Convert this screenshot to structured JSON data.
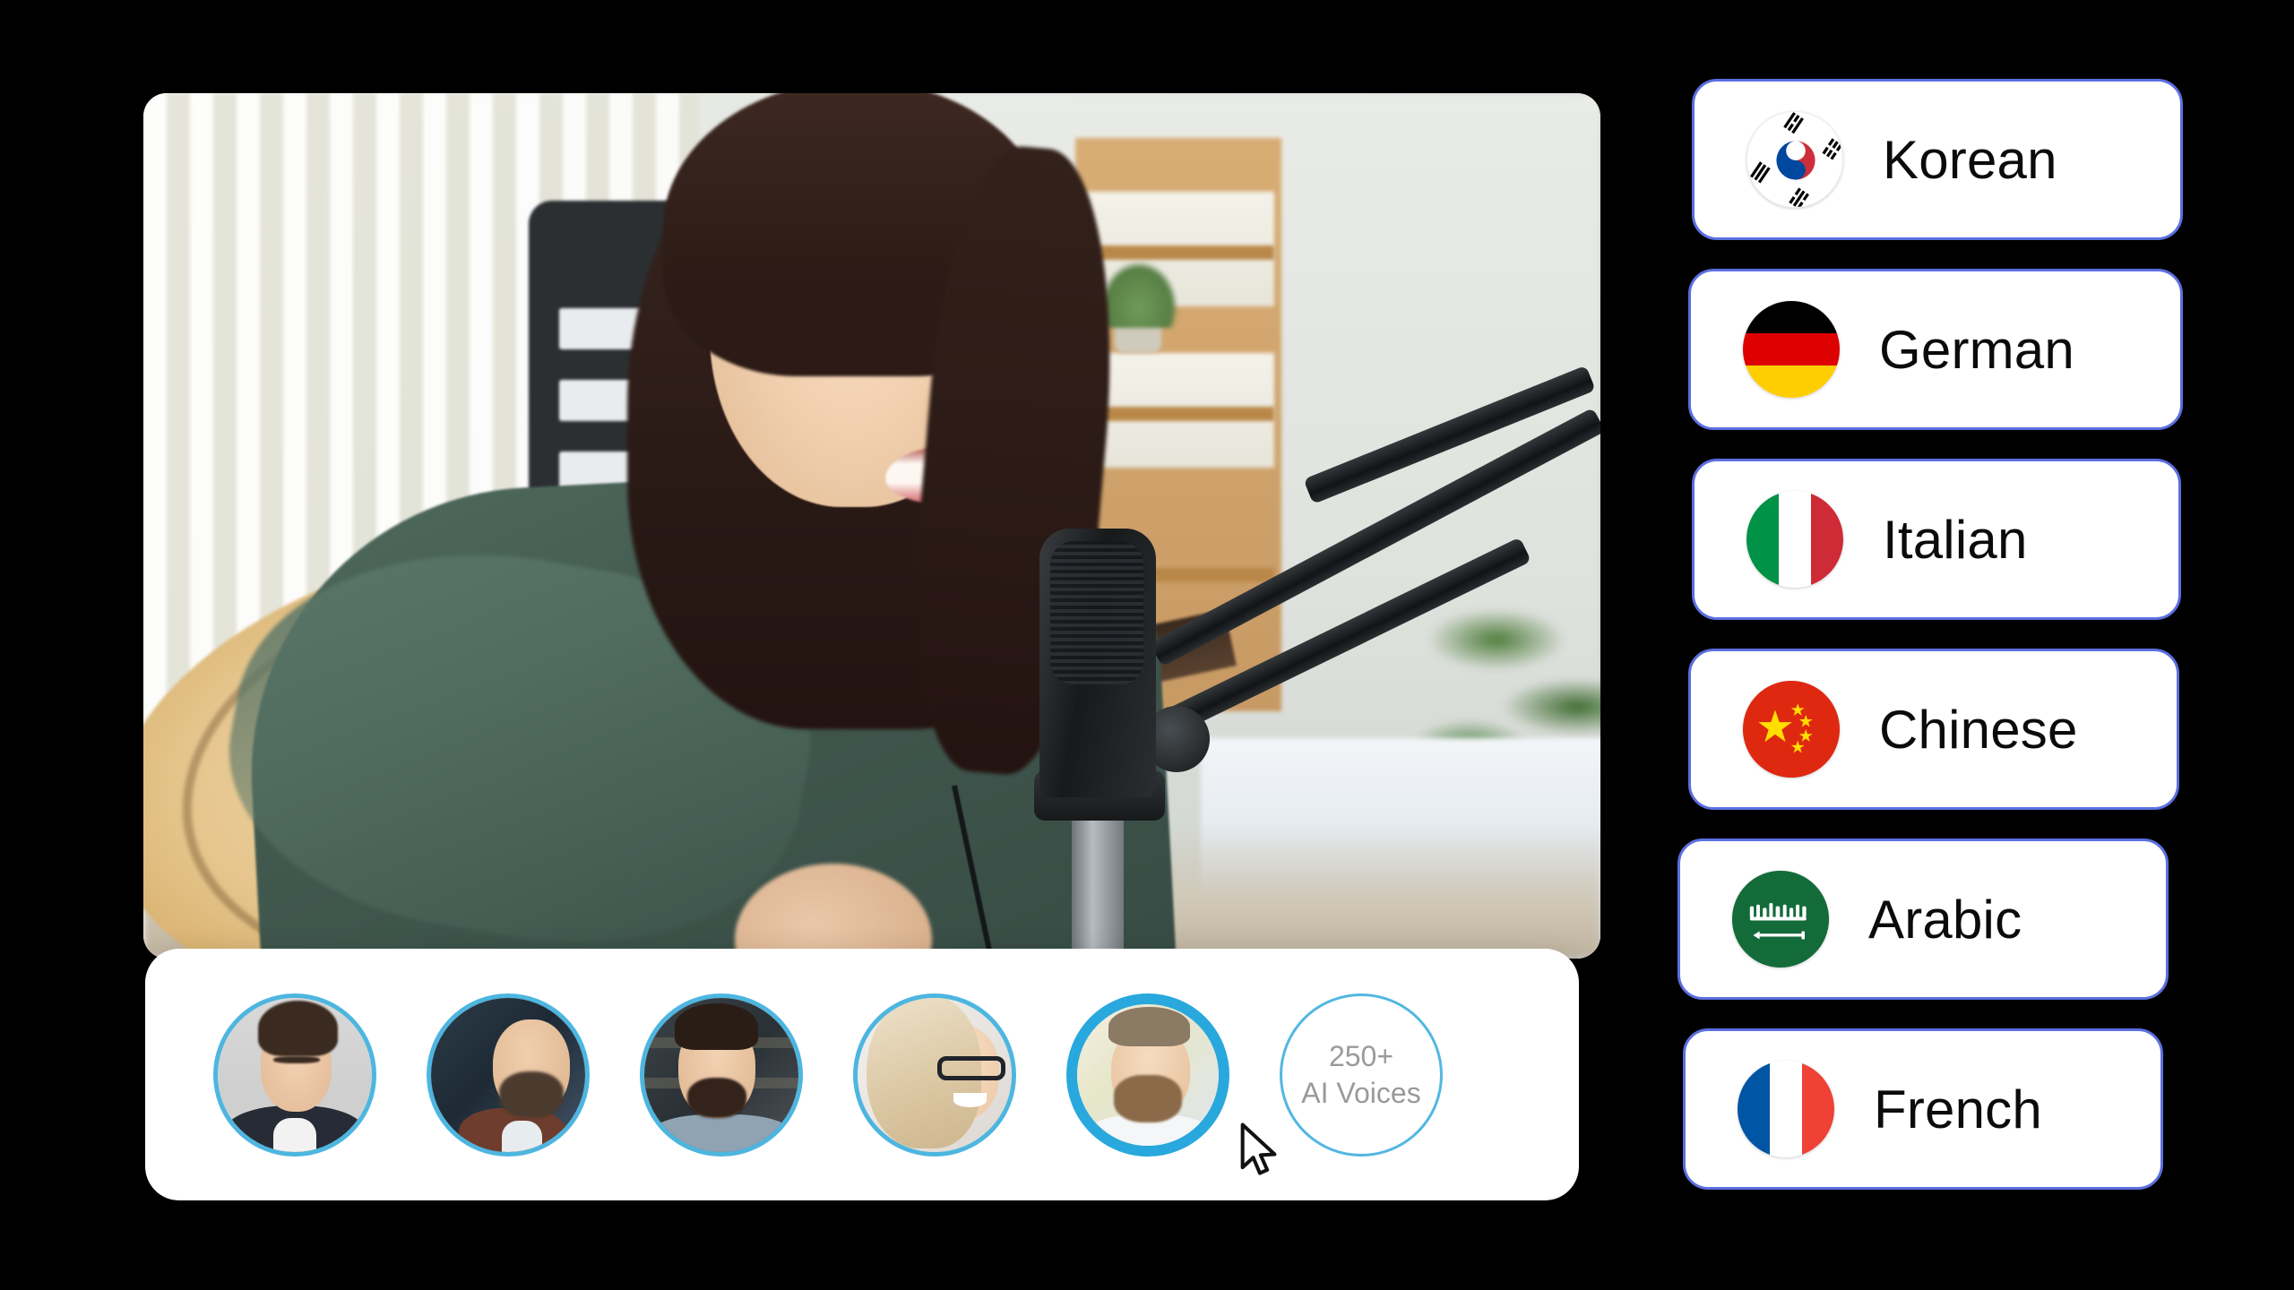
{
  "video_panel": {
    "scene_description": "Woman playing acoustic guitar and singing into a studio microphone in a home office"
  },
  "voice_bar": {
    "avatars": [
      {
        "name": "voice-avatar-1",
        "description": "Young man with short dark hair in a dark suit",
        "selected": false
      },
      {
        "name": "voice-avatar-2",
        "description": "Bald bearded man in a maroon sweater",
        "selected": false
      },
      {
        "name": "voice-avatar-3",
        "description": "Dark haired bearded man in a blue shirt",
        "selected": false
      },
      {
        "name": "voice-avatar-4",
        "description": "Blonde woman wearing black glasses",
        "selected": false
      },
      {
        "name": "voice-avatar-5",
        "description": "Bearded blond man in a white shirt",
        "selected": true
      }
    ],
    "more_voices": {
      "count_label": "250+",
      "caption_label": "AI Voices"
    },
    "cursor": {
      "icon": "cursor-arrow-icon"
    }
  },
  "languages": {
    "items": [
      {
        "label": "Korean",
        "flag_icon": "flag-south-korea-icon",
        "flag_class": "f-kr"
      },
      {
        "label": "German",
        "flag_icon": "flag-germany-icon",
        "flag_class": "f-de"
      },
      {
        "label": "Italian",
        "flag_icon": "flag-italy-icon",
        "flag_class": "f-it"
      },
      {
        "label": "Chinese",
        "flag_icon": "flag-china-icon",
        "flag_class": "f-cn"
      },
      {
        "label": "Arabic",
        "flag_icon": "flag-saudi-arabia-icon",
        "flag_class": "f-sa"
      },
      {
        "label": "French",
        "flag_icon": "flag-france-icon",
        "flag_class": "f-fr"
      }
    ]
  },
  "colors": {
    "background": "#000000",
    "card_border": "#5b6fe0",
    "avatar_ring": "#4db6e0",
    "avatar_ring_selected": "#29a8dd",
    "more_voices_text": "#9a9a9a",
    "card_surface": "#ffffff"
  }
}
